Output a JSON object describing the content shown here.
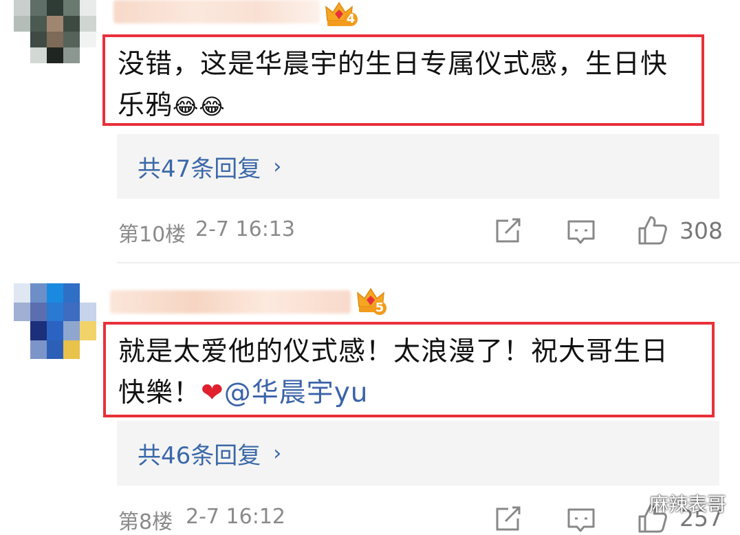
{
  "comments": [
    {
      "level_badge": "4",
      "text_line1": "没错，这是华晨宇的生日专属仪式感，生日快",
      "text_line2": "乐鸦",
      "emoji": "😂😂",
      "reply_label": "共47条回复",
      "floor": "第10楼",
      "time": "2-7 16:13",
      "likes": "308"
    },
    {
      "level_badge": "5",
      "text_line1": "就是太爱他的仪式感！太浪漫了！祝大哥生日",
      "text_line2": "快樂！",
      "heart": "❤",
      "mention": "@华晨宇yu",
      "reply_label": "共46条回复",
      "floor": "第8楼",
      "time": "2-7 16:12",
      "likes": "257"
    }
  ],
  "icons": {
    "reply_chevron": "›",
    "share": "share-icon",
    "comment": "comment-icon",
    "like": "thumbs-up-icon"
  },
  "watermark": {
    "text": "麻辣表哥"
  },
  "colors": {
    "highlight_border": "#e8303a",
    "link_blue": "#3a68a9",
    "meta_gray": "#8a8a8a"
  }
}
